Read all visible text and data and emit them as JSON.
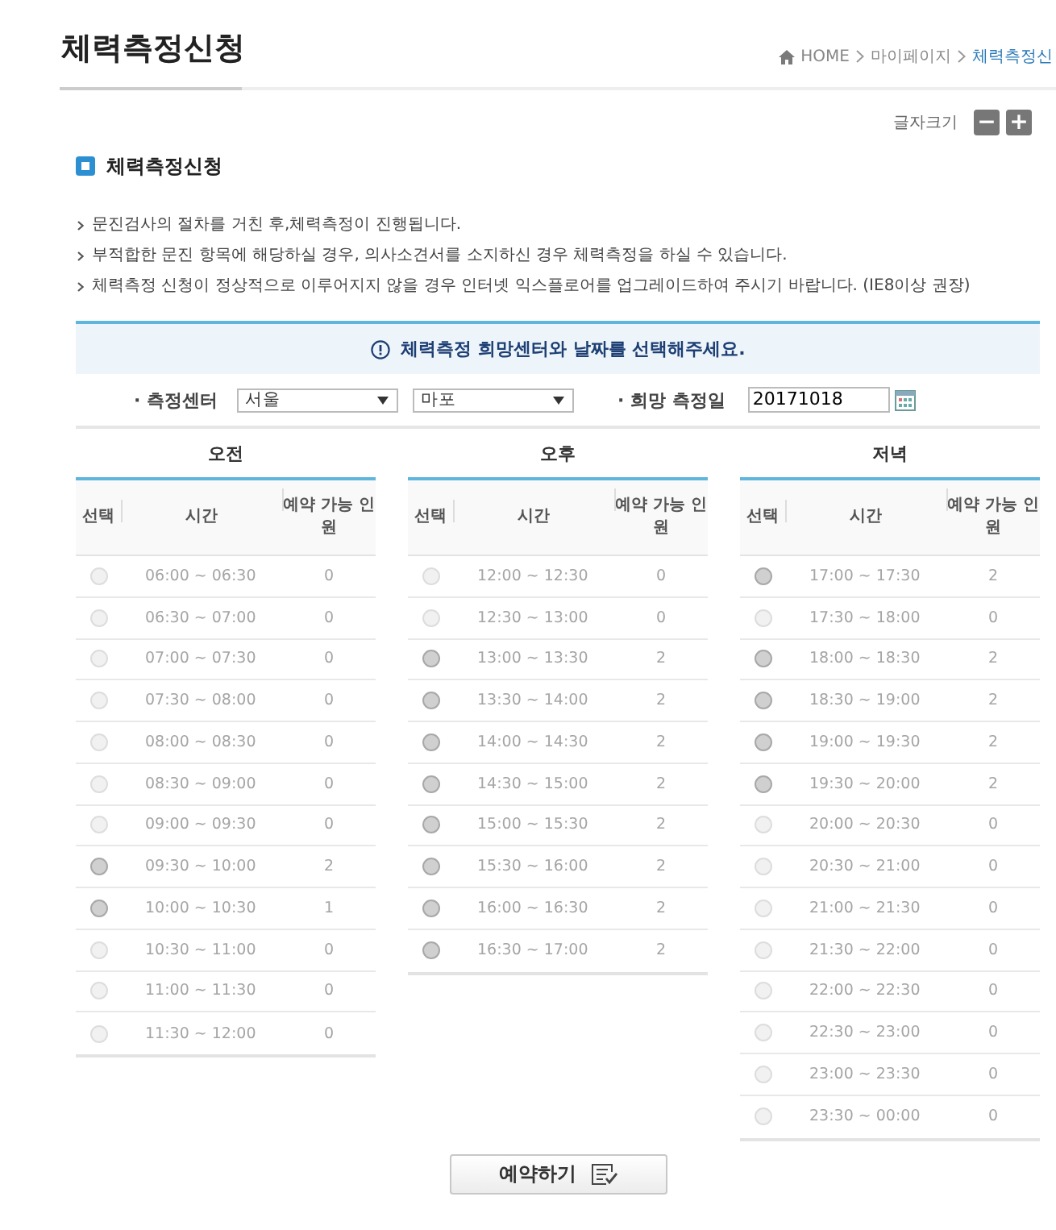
{
  "page": {
    "title": "체력측정신청"
  },
  "breadcrumb": [
    {
      "label": "HOME",
      "current": false
    },
    {
      "label": "마이페이지",
      "current": false
    },
    {
      "label": "체력측정신",
      "current": true
    }
  ],
  "font_size": {
    "label": "글자크기",
    "decrease": "−",
    "increase": "+"
  },
  "section": {
    "heading": "체력측정신청"
  },
  "notes": [
    "문진검사의 절차를 거친 후,체력측정이 진행됩니다.",
    "부적합한 문진 항목에 해당하실 경우, 의사소견서를 소지하신 경우 체력측정을 하실 수 있습니다.",
    "체력측정 신청이 정상적으로 이루어지지 않을 경우 인터넷 익스플로어를 업그레이드하여 주시기 바랍니다. (IE8이상 권장)"
  ],
  "notice": {
    "text": "체력측정 희망센터와 날짜를 선택해주세요."
  },
  "form": {
    "center_label": "· 측정센터",
    "region_select": {
      "value": "서울"
    },
    "branch_select": {
      "value": "마포"
    },
    "date_label": "· 희망 측정일",
    "date_field": {
      "value": "20171018"
    }
  },
  "periods": [
    {
      "title": "오전",
      "columns": [
        "선택",
        "시간",
        "예약 가능 인원"
      ],
      "slots": [
        {
          "time": "06:00 ~ 06:30",
          "count": "0",
          "selected": false,
          "disabled": true
        },
        {
          "time": "06:30 ~ 07:00",
          "count": "0",
          "selected": false,
          "disabled": true
        },
        {
          "time": "07:00 ~ 07:30",
          "count": "0",
          "selected": false,
          "disabled": true
        },
        {
          "time": "07:30 ~ 08:00",
          "count": "0",
          "selected": false,
          "disabled": true
        },
        {
          "time": "08:00 ~ 08:30",
          "count": "0",
          "selected": false,
          "disabled": true
        },
        {
          "time": "08:30 ~ 09:00",
          "count": "0",
          "selected": false,
          "disabled": true
        },
        {
          "time": "09:00 ~ 09:30",
          "count": "0",
          "selected": false,
          "disabled": true
        },
        {
          "time": "09:30 ~ 10:00",
          "count": "2",
          "selected": false,
          "disabled": false
        },
        {
          "time": "10:00 ~ 10:30",
          "count": "1",
          "selected": false,
          "disabled": false
        },
        {
          "time": "10:30 ~ 11:00",
          "count": "0",
          "selected": false,
          "disabled": true
        },
        {
          "time": "11:00 ~ 11:30",
          "count": "0",
          "selected": false,
          "disabled": true
        },
        {
          "time": "11:30 ~ 12:00",
          "count": "0",
          "selected": false,
          "disabled": true
        }
      ]
    },
    {
      "title": "오후",
      "columns": [
        "선택",
        "시간",
        "예약 가능 인원"
      ],
      "slots": [
        {
          "time": "12:00 ~ 12:30",
          "count": "0",
          "selected": false,
          "disabled": true
        },
        {
          "time": "12:30 ~ 13:00",
          "count": "0",
          "selected": false,
          "disabled": true
        },
        {
          "time": "13:00 ~ 13:30",
          "count": "2",
          "selected": false,
          "disabled": false
        },
        {
          "time": "13:30 ~ 14:00",
          "count": "2",
          "selected": false,
          "disabled": false
        },
        {
          "time": "14:00 ~ 14:30",
          "count": "2",
          "selected": false,
          "disabled": false
        },
        {
          "time": "14:30 ~ 15:00",
          "count": "2",
          "selected": false,
          "disabled": false
        },
        {
          "time": "15:00 ~ 15:30",
          "count": "2",
          "selected": false,
          "disabled": false
        },
        {
          "time": "15:30 ~ 16:00",
          "count": "2",
          "selected": false,
          "disabled": false
        },
        {
          "time": "16:00 ~ 16:30",
          "count": "2",
          "selected": false,
          "disabled": false
        },
        {
          "time": "16:30 ~ 17:00",
          "count": "2",
          "selected": false,
          "disabled": false
        }
      ]
    },
    {
      "title": "저녁",
      "columns": [
        "선택",
        "시간",
        "예약 가능 인원"
      ],
      "slots": [
        {
          "time": "17:00 ~ 17:30",
          "count": "2",
          "selected": false,
          "disabled": false
        },
        {
          "time": "17:30 ~ 18:00",
          "count": "0",
          "selected": false,
          "disabled": true
        },
        {
          "time": "18:00 ~ 18:30",
          "count": "2",
          "selected": false,
          "disabled": false
        },
        {
          "time": "18:30 ~ 19:00",
          "count": "2",
          "selected": false,
          "disabled": false
        },
        {
          "time": "19:00 ~ 19:30",
          "count": "2",
          "selected": false,
          "disabled": false
        },
        {
          "time": "19:30 ~ 20:00",
          "count": "2",
          "selected": false,
          "disabled": false
        },
        {
          "time": "20:00 ~ 20:30",
          "count": "0",
          "selected": false,
          "disabled": true
        },
        {
          "time": "20:30 ~ 21:00",
          "count": "0",
          "selected": false,
          "disabled": true
        },
        {
          "time": "21:00 ~ 21:30",
          "count": "0",
          "selected": false,
          "disabled": true
        },
        {
          "time": "21:30 ~ 22:00",
          "count": "0",
          "selected": false,
          "disabled": true
        },
        {
          "time": "22:00 ~ 22:30",
          "count": "0",
          "selected": false,
          "disabled": true
        },
        {
          "time": "22:30 ~ 23:00",
          "count": "0",
          "selected": false,
          "disabled": true
        },
        {
          "time": "23:00 ~ 23:30",
          "count": "0",
          "selected": false,
          "disabled": true
        },
        {
          "time": "23:30 ~ 00:00",
          "count": "0",
          "selected": false,
          "disabled": true
        }
      ]
    }
  ],
  "submit_button": {
    "label": "예약하기"
  }
}
